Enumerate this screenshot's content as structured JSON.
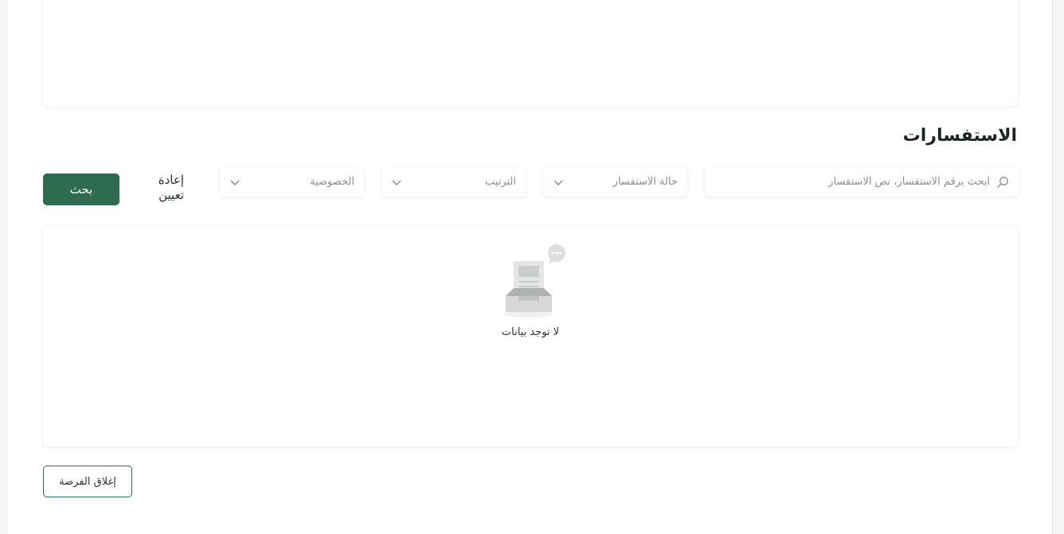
{
  "section_title": "الاستفسارات",
  "search": {
    "placeholder": "ابحث برقم الاستفسار، نص الاستفسار",
    "icon": "search-icon"
  },
  "filters": {
    "status_label": "حالة الاستفسار",
    "order_label": "الترتيب",
    "privacy_label": "الخصوصية",
    "icon": "chevron-down-icon"
  },
  "actions": {
    "reset_label": "إعادة تعيين",
    "search_label": "بحث",
    "close_label": "إغلاق الفرصة"
  },
  "results": {
    "empty_text": "لا توجد بيانات",
    "empty_icon": "empty-inbox-icon"
  },
  "colors": {
    "primary": "#2f6b4f",
    "placeholder": "#8a8f8c"
  }
}
